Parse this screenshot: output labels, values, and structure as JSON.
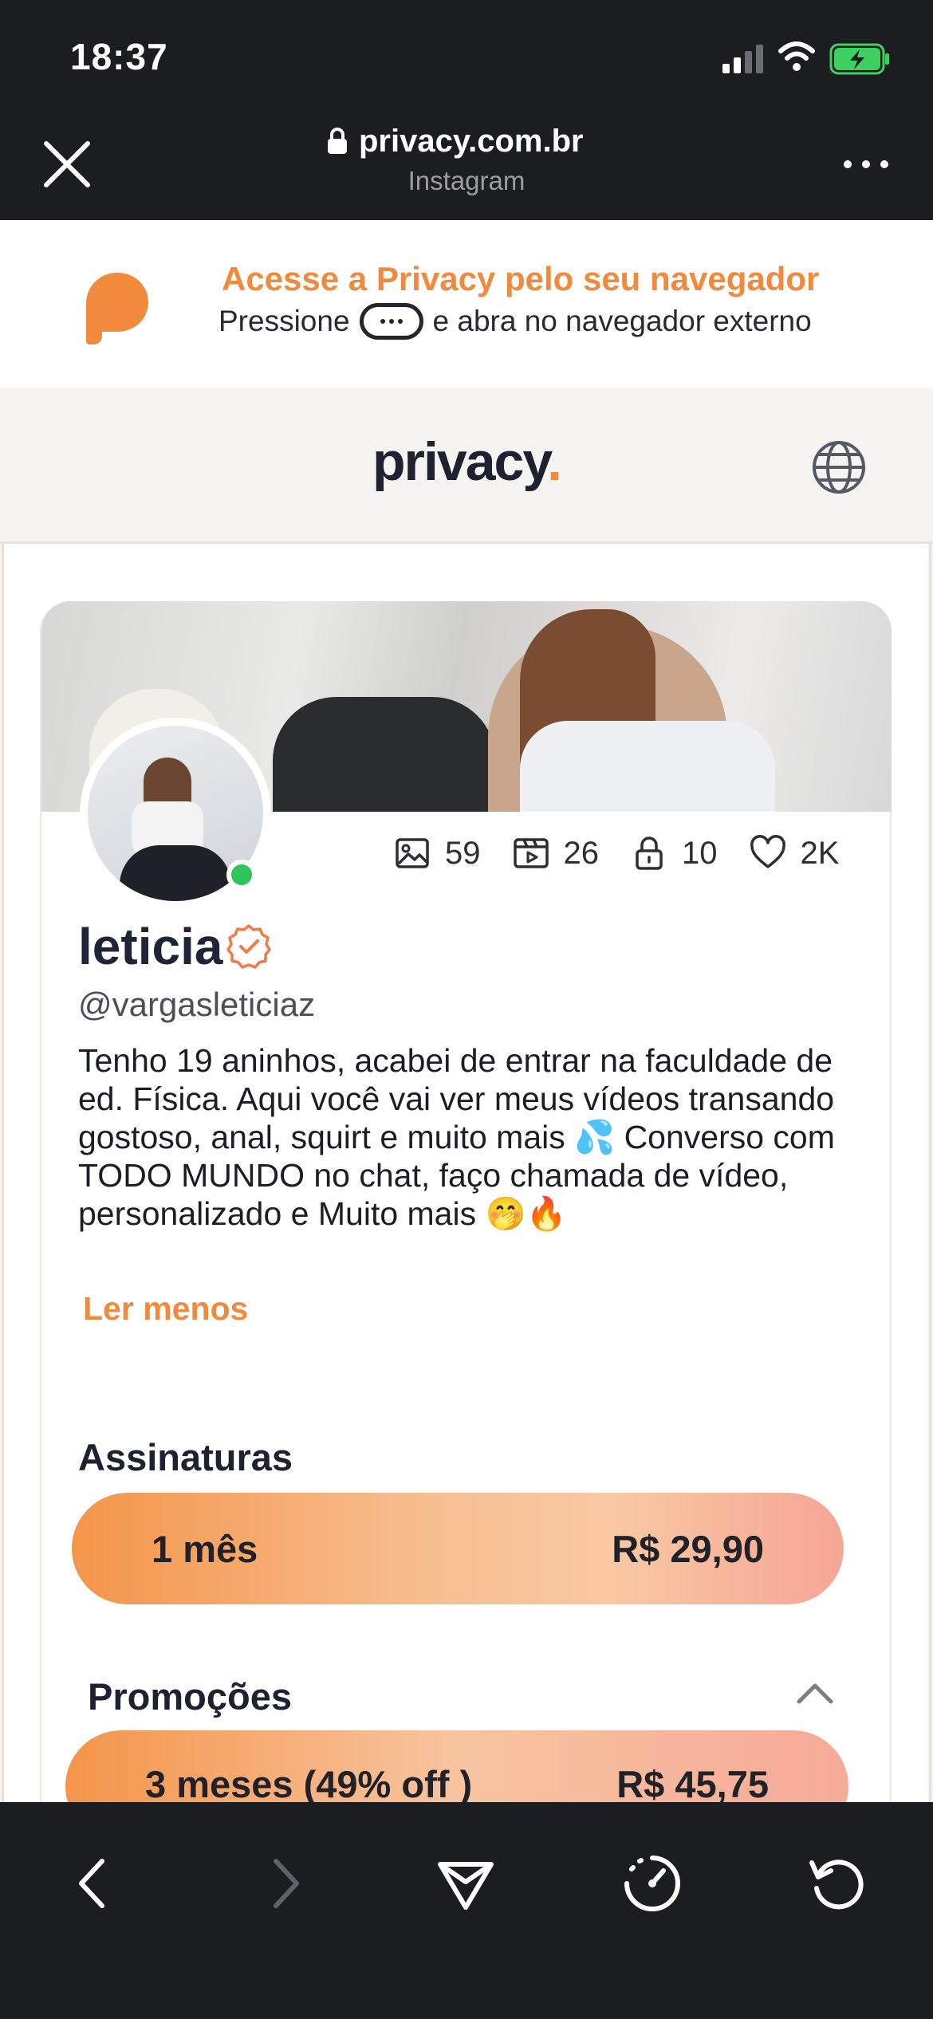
{
  "status_bar": {
    "time": "18:37"
  },
  "browser": {
    "url": "privacy.com.br",
    "source": "Instagram"
  },
  "banner": {
    "title": "Acesse a Privacy pelo seu navegador",
    "sub_before": "Pressione",
    "sub_after": "e abra no navegador externo"
  },
  "site": {
    "logo": "privacy",
    "logo_dot": "."
  },
  "profile": {
    "name": "leticia",
    "handle": "@vargasleticiaz",
    "bio": "Tenho 19 aninhos, acabei de entrar na faculdade de ed. Física. Aqui você vai ver meus vídeos transando gostoso, anal, squirt e muito mais 💦 Converso com TODO MUNDO no chat, faço chamada de vídeo, personalizado e Muito mais 🤭🔥",
    "read_less": "Ler menos",
    "stats": {
      "photos": "59",
      "videos": "26",
      "locked": "10",
      "likes": "2K"
    }
  },
  "subscriptions": {
    "title": "Assinaturas",
    "plan": {
      "period": "1 mês",
      "price": "R$ 29,90"
    }
  },
  "promotions": {
    "title": "Promoções",
    "plan": {
      "label": "3 meses (49% off )",
      "price": "R$ 45,75"
    }
  },
  "colors": {
    "accent": "#f18a3d",
    "online": "#2fc55b",
    "dark_bg": "#1b1d20"
  },
  "icons": [
    "close-icon",
    "lock-icon",
    "more-icon",
    "privacy-logo-icon",
    "globe-icon",
    "image-icon",
    "video-icon",
    "lock-icon",
    "heart-icon",
    "verified-icon",
    "chevron-up-icon",
    "back-icon",
    "forward-icon",
    "share-icon",
    "speed-icon",
    "reload-icon"
  ]
}
